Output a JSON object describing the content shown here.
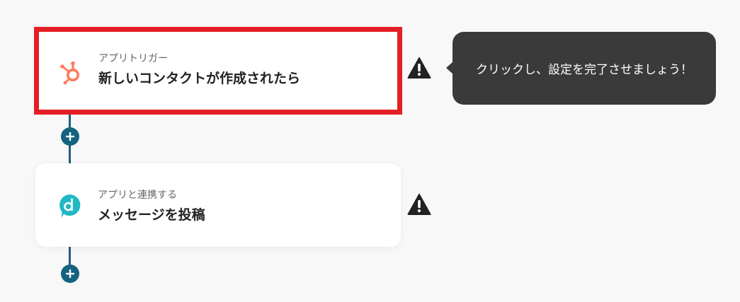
{
  "flow": {
    "steps": [
      {
        "category": "アプリトリガー",
        "title": "新しいコンタクトが作成されたら",
        "app_icon": "hubspot-icon",
        "warning": true,
        "selected": true
      },
      {
        "category": "アプリと連携する",
        "title": "メッセージを投稿",
        "app_icon": "direct-icon",
        "warning": true,
        "selected": false
      }
    ],
    "add_step_icon": "plus-icon"
  },
  "tooltip": {
    "text": "クリックし、設定を完了させましょう！"
  },
  "colors": {
    "highlight_border": "#e31e24",
    "connector": "#14627f",
    "hubspot_orange": "#ff7a59",
    "direct_teal": "#1fb8c4",
    "tooltip_bg": "#3a3a3a",
    "warning": "#222222"
  }
}
